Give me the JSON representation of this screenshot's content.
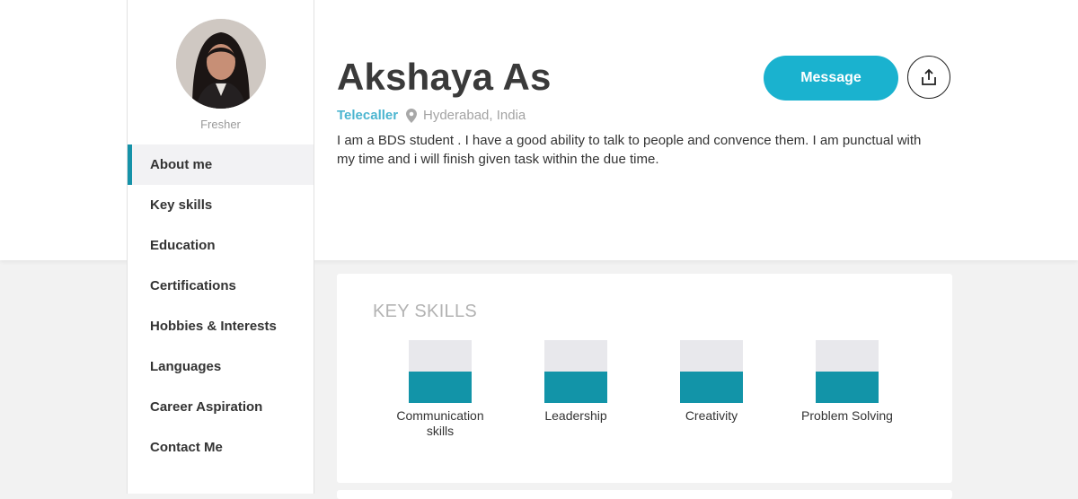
{
  "profile": {
    "name": "Akshaya As",
    "status": "Fresher",
    "role": "Telecaller",
    "location": "Hyderabad, India",
    "bio": "I am a BDS student . I have a good ability to talk to people and convence them. I am punctual with my time and i will finish given task within the due time."
  },
  "actions": {
    "message_label": "Message",
    "share_icon": "share-upload-icon"
  },
  "sidebar": {
    "items": [
      {
        "label": "About me",
        "active": true
      },
      {
        "label": "Key skills"
      },
      {
        "label": "Education"
      },
      {
        "label": "Certifications"
      },
      {
        "label": "Hobbies & Interests"
      },
      {
        "label": "Languages"
      },
      {
        "label": "Career Aspiration"
      },
      {
        "label": "Contact Me"
      }
    ]
  },
  "key_skills": {
    "heading": "KEY SKILLS",
    "skills": [
      {
        "label": "Communication skills",
        "level": 0.5
      },
      {
        "label": "Leadership",
        "level": 0.5
      },
      {
        "label": "Creativity",
        "level": 0.5
      },
      {
        "label": "Problem Solving",
        "level": 0.5
      }
    ]
  },
  "colors": {
    "accent": "#1ab2cf",
    "role": "#4bb5d0",
    "skill_fill": "#1294a8",
    "active_nav_border": "#1592a8"
  }
}
